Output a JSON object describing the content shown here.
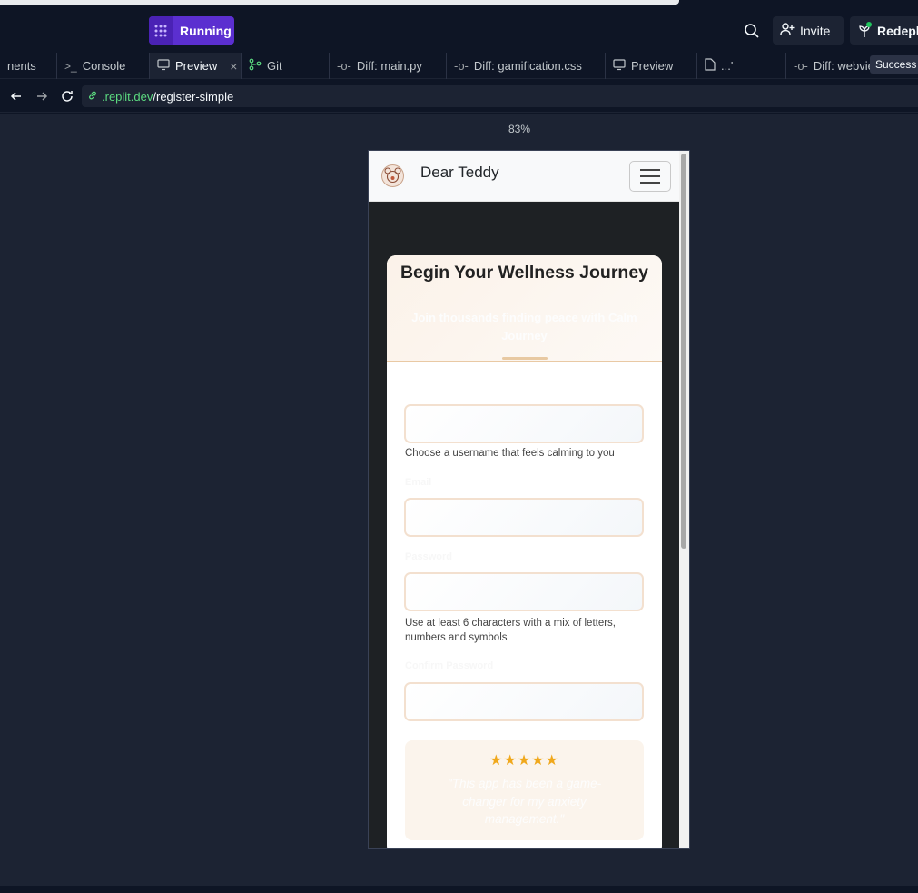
{
  "header": {
    "run_label": "Running",
    "invite_label": "Invite",
    "redeploy_label": "Redeploy"
  },
  "tabs": [
    {
      "label": "nents",
      "icon": "none"
    },
    {
      "label": "Console",
      "icon": "terminal-icon"
    },
    {
      "label": "Preview",
      "icon": "monitor-icon",
      "active": true
    },
    {
      "label": "Git",
      "icon": "git-icon"
    },
    {
      "label": "Diff: main.py",
      "icon": "commit-icon"
    },
    {
      "label": "Diff: gamification.css",
      "icon": "commit-icon"
    },
    {
      "label": "Preview",
      "icon": "monitor-icon"
    },
    {
      "label": "...'",
      "icon": "file-icon"
    },
    {
      "label": "Diff: webvie",
      "icon": "commit-icon"
    }
  ],
  "tooltip": "Success",
  "url": {
    "host": ".replit.dev",
    "path": "/register-simple"
  },
  "zoom": "83%",
  "app": {
    "brand": "Dear Teddy",
    "card": {
      "title": "Begin Your Wellness Journey",
      "subtitle": "Join thousands finding peace with Calm Journey"
    },
    "fields": {
      "username_help": "Choose a username that feels calming to you",
      "email_label": "Email",
      "password_label": "Password",
      "password_help": "Use at least 6 characters with a mix of letters, numbers and symbols",
      "confirm_label": "Confirm Password"
    },
    "testimonial": {
      "stars": "★★★★★",
      "rating": 5,
      "quote": "\"This app has been a game-changer for my anxiety management.\""
    }
  },
  "colors": {
    "run_purple": "#5b2fd0",
    "url_host_green": "#5cdb80",
    "star_gold": "#f0a81c"
  }
}
